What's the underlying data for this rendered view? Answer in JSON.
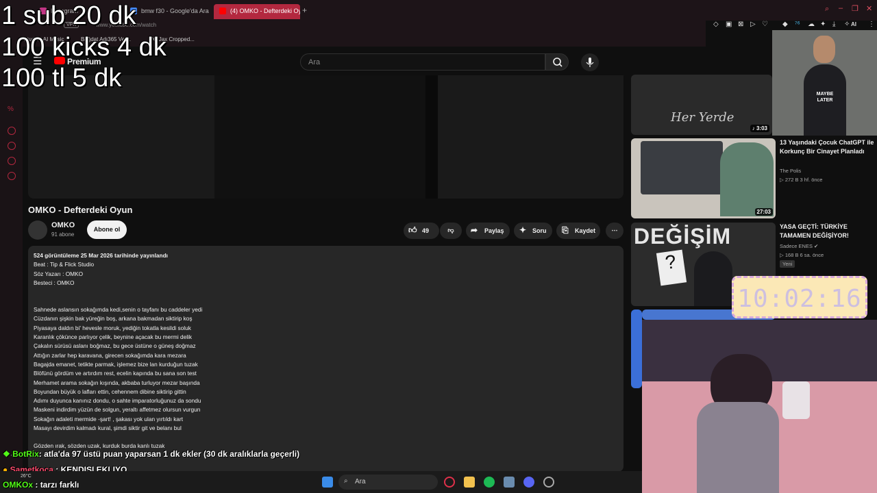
{
  "browser": {
    "tabs": [
      {
        "label": "Instagram",
        "color": "#c13584"
      },
      {
        "label": "bmw f30 - Google'da Ara",
        "color": "#4285f4"
      },
      {
        "label": "(4) OMKO - Defterdeki Oyu",
        "color": "#ff0000"
      }
    ],
    "url": "www.youtube.com/watch",
    "vpn_label": "VPN",
    "bookmarks": [
      "Studio | AI Music",
      "Bağdat Adı365 Ver...",
      "DC Jax Cropped..."
    ],
    "ai_label": "AI"
  },
  "youtube": {
    "logo_label": "Premium",
    "search_placeholder": "Ara",
    "video": {
      "title": "OMKO - Defterdeki Oyun",
      "channel": "OMKO",
      "subscribers": "91 abone",
      "subscribe_label": "Abone ol",
      "likes": "49",
      "share_label": "Paylaş",
      "ask_label": "Soru",
      "save_label": "Kaydet"
    },
    "description": {
      "stats": "524 görüntüleme  25 Mar 2026 tarihinde yayınlandı",
      "credits": [
        "Beat : Tip & Flick Studio",
        "Söz Yazarı : OMKO",
        "Besteci : OMKO"
      ],
      "lyrics": [
        "Sahnede aslansın sokağımda kedi,senin o tayfanı bu caddeler yedi",
        "Cüzdanın şişkin bak yüreğin boş, arkana bakmadan siktirip koş",
        "Piyasaya daldın bi' hevesle moruk, yediğin tokatla kesildi soluk",
        "Karanlık çökünce parlıyor çelik, beynine açacak bu mermi delik",
        "Çakalın sürüsü aslanı boğmaz, bu gece üstüne o güneş doğmaz",
        "Attığın zarlar hep karavana, girecen sokağımda kara mezara",
        "Bagajda emanet, tetikte parmak, işlemez bize lan kurduğun tuzak",
        "Blöfünü gördüm ve artırdım rest, ecelin kapında bu sana son test",
        "Merhamet arama sokağın kışında, akbaba turluyor mezar başında",
        "Boyundan büyük o lafları ettin, cehennem dibine siktirip gittin",
        "Adımı duyunca kanınız dondu, o sahte imparatorluğunuz da sondu",
        "Maskeni indirdim yüzün de solgun, yeraltı affetmez olursun vurgun",
        "Sokağın adaleti mermide -şart! , şakası yok ulan yırtıldı kart",
        "Masayı devirdim kalmadı kural, şimdi siktir git ve belanı bul"
      ],
      "lyrics2": [
        "Gözden ırak, sözden uzak, kurduk burda kanlı tuzak"
      ]
    },
    "recommendations": [
      {
        "title": "Her Yerde",
        "duration": "3:03",
        "channel": "",
        "meta": ""
      },
      {
        "title": "13 Yaşındaki Çocuk ChatGPT ile Korkunç Bir Cinayet Planladı",
        "duration": "27:03",
        "channel": "The Polis",
        "meta": "▷ 272 B   3 hf. önce"
      },
      {
        "title": "YASA GEÇTİ: TÜRKİYE TAMAMEN DEĞİŞİYOR!",
        "duration": "",
        "channel": "Sadece ENES",
        "meta": "▷ 168 B   6 sa. önce",
        "badge": "Yeni",
        "thumb_text": "DEĞİŞİM"
      }
    ]
  },
  "stream_overlay": {
    "goals": [
      "1 sub 20 dk",
      "100 kicks 4 dk",
      "100 tl 5 dk"
    ],
    "clock": "10:02:16",
    "webcam_shirt": "MAYBE LATER",
    "chat": [
      {
        "user": "BotRix",
        "sep": ": ",
        "text": "atla'da 97 üstü puan yaparsan 1 dk ekler (30 dk aralıklarla geçerli)",
        "color": "#53fc18"
      },
      {
        "user": "Sametkoca",
        "sep": " : ",
        "text": "KENDISI EKLIYO",
        "color": "#ff4b6e"
      },
      {
        "user": "OMKOx",
        "sep": " : ",
        "text": "tarzı farklı",
        "color": "#53fc18"
      }
    ]
  },
  "taskbar": {
    "search_placeholder": "Ara",
    "weather": "26°C"
  }
}
